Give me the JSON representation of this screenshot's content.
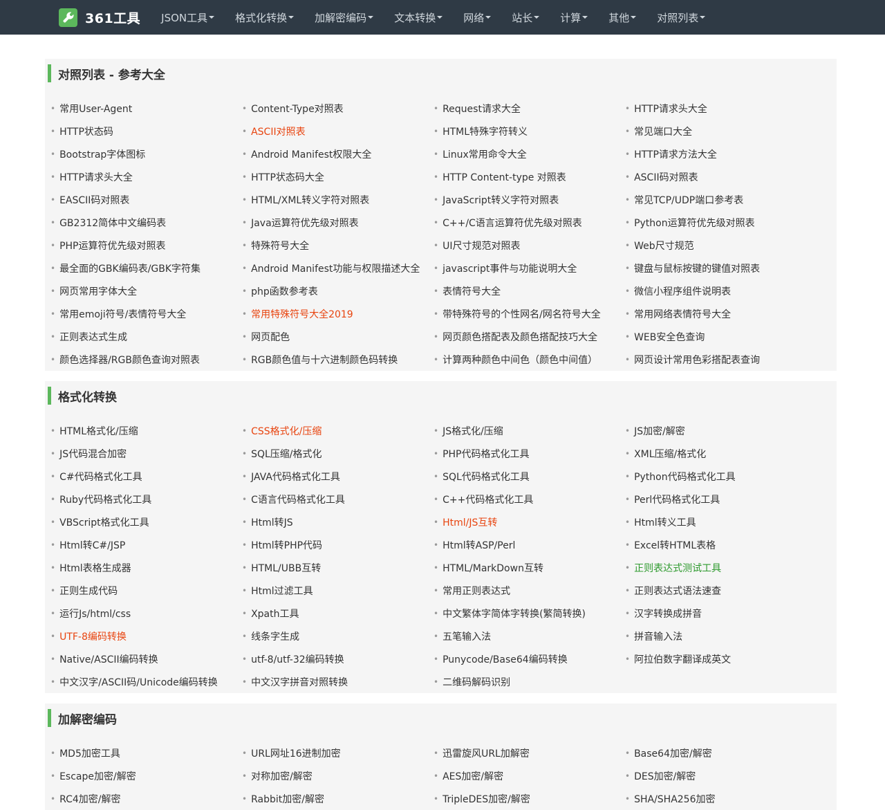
{
  "brand": {
    "name": "361工具"
  },
  "nav": [
    "JSON工具",
    "格式化转换",
    "加解密编码",
    "文本转换",
    "网络",
    "站长",
    "计算",
    "其他",
    "对照列表"
  ],
  "colors": {
    "navbar": "#2f3a45",
    "accent": "#5cb85c",
    "highlight_red": "#e8440f",
    "highlight_green": "#2e9a2e"
  },
  "sections": [
    {
      "title": "对照列表 - 参考大全",
      "links": [
        {
          "text": "常用User-Agent"
        },
        {
          "text": "Content-Type对照表"
        },
        {
          "text": "Request请求大全"
        },
        {
          "text": "HTTP请求头大全"
        },
        {
          "text": "HTTP状态码"
        },
        {
          "text": "ASCII对照表",
          "hl": "red"
        },
        {
          "text": "HTML特殊字符转义"
        },
        {
          "text": "常见端口大全"
        },
        {
          "text": "Bootstrap字体图标"
        },
        {
          "text": "Android Manifest权限大全"
        },
        {
          "text": "Linux常用命令大全"
        },
        {
          "text": "HTTP请求方法大全"
        },
        {
          "text": "HTTP请求头大全"
        },
        {
          "text": "HTTP状态码大全"
        },
        {
          "text": "HTTP Content-type 对照表"
        },
        {
          "text": "ASCII码对照表"
        },
        {
          "text": "EASCII码对照表"
        },
        {
          "text": "HTML/XML转义字符对照表"
        },
        {
          "text": "JavaScript转义字符对照表"
        },
        {
          "text": "常见TCP/UDP端口参考表"
        },
        {
          "text": "GB2312简体中文编码表"
        },
        {
          "text": "Java运算符优先级对照表"
        },
        {
          "text": "C++/C语言运算符优先级对照表"
        },
        {
          "text": "Python运算符优先级对照表"
        },
        {
          "text": "PHP运算符优先级对照表"
        },
        {
          "text": "特殊符号大全"
        },
        {
          "text": "UI尺寸规范对照表"
        },
        {
          "text": "Web尺寸规范"
        },
        {
          "text": "最全面的GBK编码表/GBK字符集"
        },
        {
          "text": "Android Manifest功能与权限描述大全"
        },
        {
          "text": "javascript事件与功能说明大全"
        },
        {
          "text": "键盘与鼠标按键的键值对照表"
        },
        {
          "text": "网页常用字体大全"
        },
        {
          "text": "php函数参考表"
        },
        {
          "text": "表情符号大全"
        },
        {
          "text": "微信小程序组件说明表"
        },
        {
          "text": "常用emoji符号/表情符号大全"
        },
        {
          "text": "常用特殊符号大全2019",
          "hl": "red"
        },
        {
          "text": "带特殊符号的个性网名/网名符号大全"
        },
        {
          "text": "常用网络表情符号大全"
        },
        {
          "text": "正则表达式生成"
        },
        {
          "text": "网页配色"
        },
        {
          "text": "网页颜色搭配表及颜色搭配技巧大全"
        },
        {
          "text": "WEB安全色查询"
        },
        {
          "text": "颜色选择器/RGB颜色查询对照表"
        },
        {
          "text": "RGB颜色值与十六进制颜色码转换"
        },
        {
          "text": "计算两种颜色中间色（颜色中间值）"
        },
        {
          "text": "网页设计常用色彩搭配表查询"
        }
      ]
    },
    {
      "title": "格式化转换",
      "links": [
        {
          "text": "HTML格式化/压缩"
        },
        {
          "text": "CSS格式化/压缩",
          "hl": "red"
        },
        {
          "text": "JS格式化/压缩"
        },
        {
          "text": "JS加密/解密"
        },
        {
          "text": "JS代码混合加密"
        },
        {
          "text": "SQL压缩/格式化"
        },
        {
          "text": "PHP代码格式化工具"
        },
        {
          "text": "XML压缩/格式化"
        },
        {
          "text": "C#代码格式化工具"
        },
        {
          "text": "JAVA代码格式化工具"
        },
        {
          "text": "SQL代码格式化工具"
        },
        {
          "text": "Python代码格式化工具"
        },
        {
          "text": "Ruby代码格式化工具"
        },
        {
          "text": "C语言代码格式化工具"
        },
        {
          "text": "C++代码格式化工具"
        },
        {
          "text": "Perl代码格式化工具"
        },
        {
          "text": "VBScript格式化工具"
        },
        {
          "text": "Html转JS"
        },
        {
          "text": "Html/JS互转",
          "hl": "red"
        },
        {
          "text": "Html转义工具"
        },
        {
          "text": "Html转C#/JSP"
        },
        {
          "text": "Html转PHP代码"
        },
        {
          "text": "Html转ASP/Perl"
        },
        {
          "text": "Excel转HTML表格"
        },
        {
          "text": "Html表格生成器"
        },
        {
          "text": "HTML/UBB互转"
        },
        {
          "text": "HTML/MarkDown互转"
        },
        {
          "text": "正则表达式测试工具",
          "hl": "green"
        },
        {
          "text": "正则生成代码"
        },
        {
          "text": "Html过滤工具"
        },
        {
          "text": "常用正则表达式"
        },
        {
          "text": "正则表达式语法速查"
        },
        {
          "text": "运行Js/html/css"
        },
        {
          "text": "Xpath工具"
        },
        {
          "text": "中文繁体字简体字转换(繁简转换)"
        },
        {
          "text": "汉字转换成拼音"
        },
        {
          "text": "UTF-8编码转换",
          "hl": "red"
        },
        {
          "text": "线条字生成"
        },
        {
          "text": "五笔输入法"
        },
        {
          "text": "拼音输入法"
        },
        {
          "text": "Native/ASCII编码转换"
        },
        {
          "text": "utf-8/utf-32编码转换"
        },
        {
          "text": "Punycode/Base64编码转换"
        },
        {
          "text": "阿拉伯数字翻译成英文"
        },
        {
          "text": "中文汉字/ASCII码/Unicode编码转换"
        },
        {
          "text": "中文汉字拼音对照转换"
        },
        {
          "text": "二维码解码识别"
        }
      ]
    },
    {
      "title": "加解密编码",
      "links": [
        {
          "text": "MD5加密工具"
        },
        {
          "text": "URL网址16进制加密"
        },
        {
          "text": "迅雷旋风URL加解密"
        },
        {
          "text": "Base64加密/解密"
        },
        {
          "text": "Escape加密/解密"
        },
        {
          "text": "对称加密/解密"
        },
        {
          "text": "AES加密/解密"
        },
        {
          "text": "DES加密/解密"
        },
        {
          "text": "RC4加密/解密"
        },
        {
          "text": "Rabbit加密/解密"
        },
        {
          "text": "TripleDES加密/解密"
        },
        {
          "text": "SHA/SHA256加密"
        }
      ]
    }
  ]
}
